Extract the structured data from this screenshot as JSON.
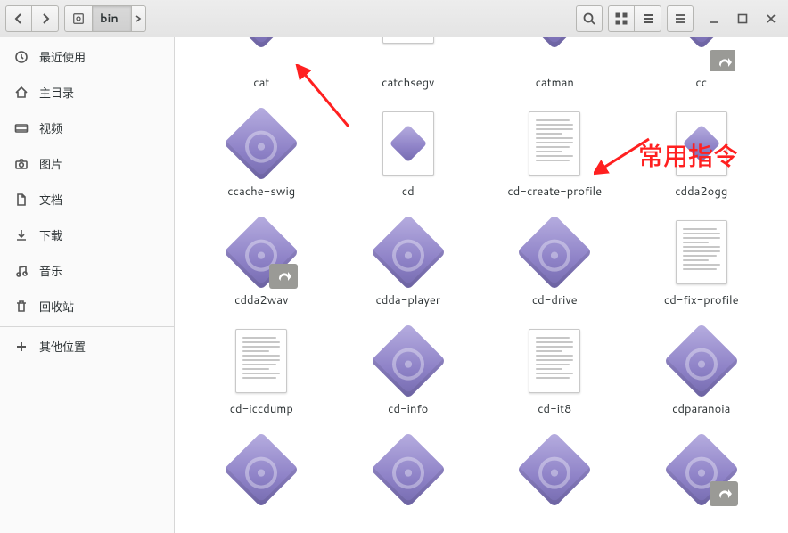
{
  "toolbar": {
    "path_current": "bin"
  },
  "sidebar": {
    "items": [
      {
        "label": "最近使用",
        "icon": "clock-icon"
      },
      {
        "label": "主目录",
        "icon": "home-icon"
      },
      {
        "label": "视频",
        "icon": "video-icon"
      },
      {
        "label": "图片",
        "icon": "camera-icon"
      },
      {
        "label": "文档",
        "icon": "doc-icon"
      },
      {
        "label": "下载",
        "icon": "download-icon"
      },
      {
        "label": "音乐",
        "icon": "music-icon"
      },
      {
        "label": "回收站",
        "icon": "trash-icon"
      }
    ],
    "other_label": "其他位置"
  },
  "files": [
    {
      "name": "cat",
      "kind": "exe",
      "row": 0,
      "link": false
    },
    {
      "name": "catchsegv",
      "kind": "script",
      "row": 0,
      "link": false
    },
    {
      "name": "catman",
      "kind": "exe",
      "row": 0,
      "link": false
    },
    {
      "name": "cc",
      "kind": "exe",
      "row": 0,
      "link": true
    },
    {
      "name": "ccache-swig",
      "kind": "exe",
      "row": 1,
      "link": false
    },
    {
      "name": "cd",
      "kind": "script",
      "row": 1,
      "link": false
    },
    {
      "name": "cd-create-profile",
      "kind": "doc",
      "row": 1,
      "link": false
    },
    {
      "name": "cdda2ogg",
      "kind": "script",
      "row": 1,
      "link": false
    },
    {
      "name": "cdda2wav",
      "kind": "exe",
      "row": 2,
      "link": true
    },
    {
      "name": "cdda-player",
      "kind": "exe",
      "row": 2,
      "link": false
    },
    {
      "name": "cd-drive",
      "kind": "exe",
      "row": 2,
      "link": false
    },
    {
      "name": "cd-fix-profile",
      "kind": "doc",
      "row": 2,
      "link": false
    },
    {
      "name": "cd-iccdump",
      "kind": "doc",
      "row": 3,
      "link": false
    },
    {
      "name": "cd-info",
      "kind": "exe",
      "row": 3,
      "link": false
    },
    {
      "name": "cd-it8",
      "kind": "doc",
      "row": 3,
      "link": false
    },
    {
      "name": "cdparanoia",
      "kind": "exe",
      "row": 3,
      "link": false
    },
    {
      "name": "",
      "kind": "exe",
      "row": 4,
      "link": false
    },
    {
      "name": "",
      "kind": "exe",
      "row": 4,
      "link": false
    },
    {
      "name": "",
      "kind": "exe",
      "row": 4,
      "link": false
    },
    {
      "name": "",
      "kind": "exe",
      "row": 4,
      "link": true
    }
  ],
  "annotation": {
    "text": "常用指令"
  }
}
